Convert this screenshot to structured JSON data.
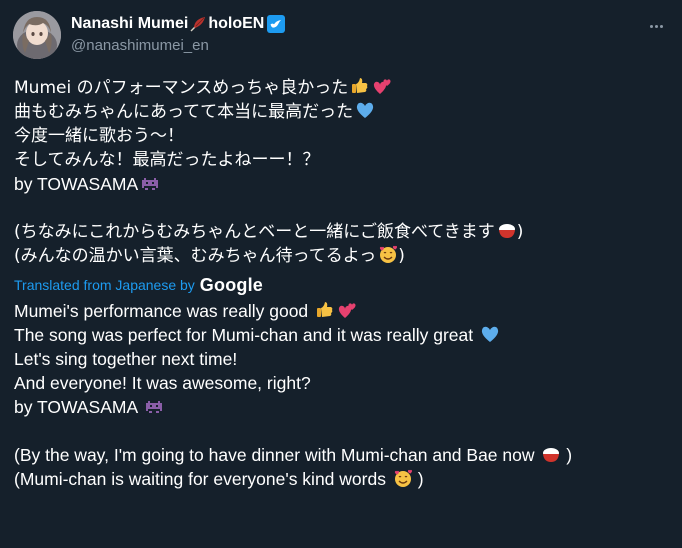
{
  "user": {
    "display_name": "Nanashi Mumei",
    "display_name_suffix": "holoEN",
    "handle": "@nanashimumei_en",
    "feather_icon": "feather-quill-icon",
    "verified_icon": "verified-badge-icon"
  },
  "original_text": {
    "line1": "Mumei のパフォーマンスめっちゃ良かった",
    "line2": "曲もむみちゃんにあってて本当に最高だった",
    "line3": "今度一緒に歌おう～！",
    "line4": "そしてみんな！最高だったよねーー！？",
    "line5": "by TOWASAMA",
    "line6": "(ちなみにこれからむみちゃんとベーと一緒にご飯食べてきます",
    "line6_end": ")",
    "line7": "(みんなの温かい言葉、むみちゃん待ってるよっ",
    "line7_end": ")"
  },
  "translation": {
    "label": "Translated from Japanese by",
    "provider": "Google",
    "line1": "Mumei's performance was really good",
    "line2": "The song was perfect for Mumi-chan and it was really great",
    "line3": "Let's sing together next time!",
    "line4": "And everyone! It was awesome, right?",
    "line5": "by TOWASAMA",
    "line6": "(By the way, I'm going to have dinner with Mumi-chan and Bae now",
    "line6_end": ")",
    "line7": "(Mumi-chan is waiting for everyone's kind words",
    "line7_end": ")"
  },
  "icons": {
    "thumbs_up": "thumbs-up-emoji-icon",
    "two_hearts": "two-hearts-emoji-icon",
    "blue_heart": "blue-heart-emoji-icon",
    "space_invader": "alien-monster-emoji-icon",
    "rice_bowl": "rice-emoji-icon",
    "smiling_hearts": "smiling-face-with-hearts-emoji-icon",
    "more": "more-options-icon"
  },
  "colors": {
    "background": "#15202b",
    "text": "#ffffff",
    "secondary": "#8b98a5",
    "accent": "#1d9bf0"
  }
}
